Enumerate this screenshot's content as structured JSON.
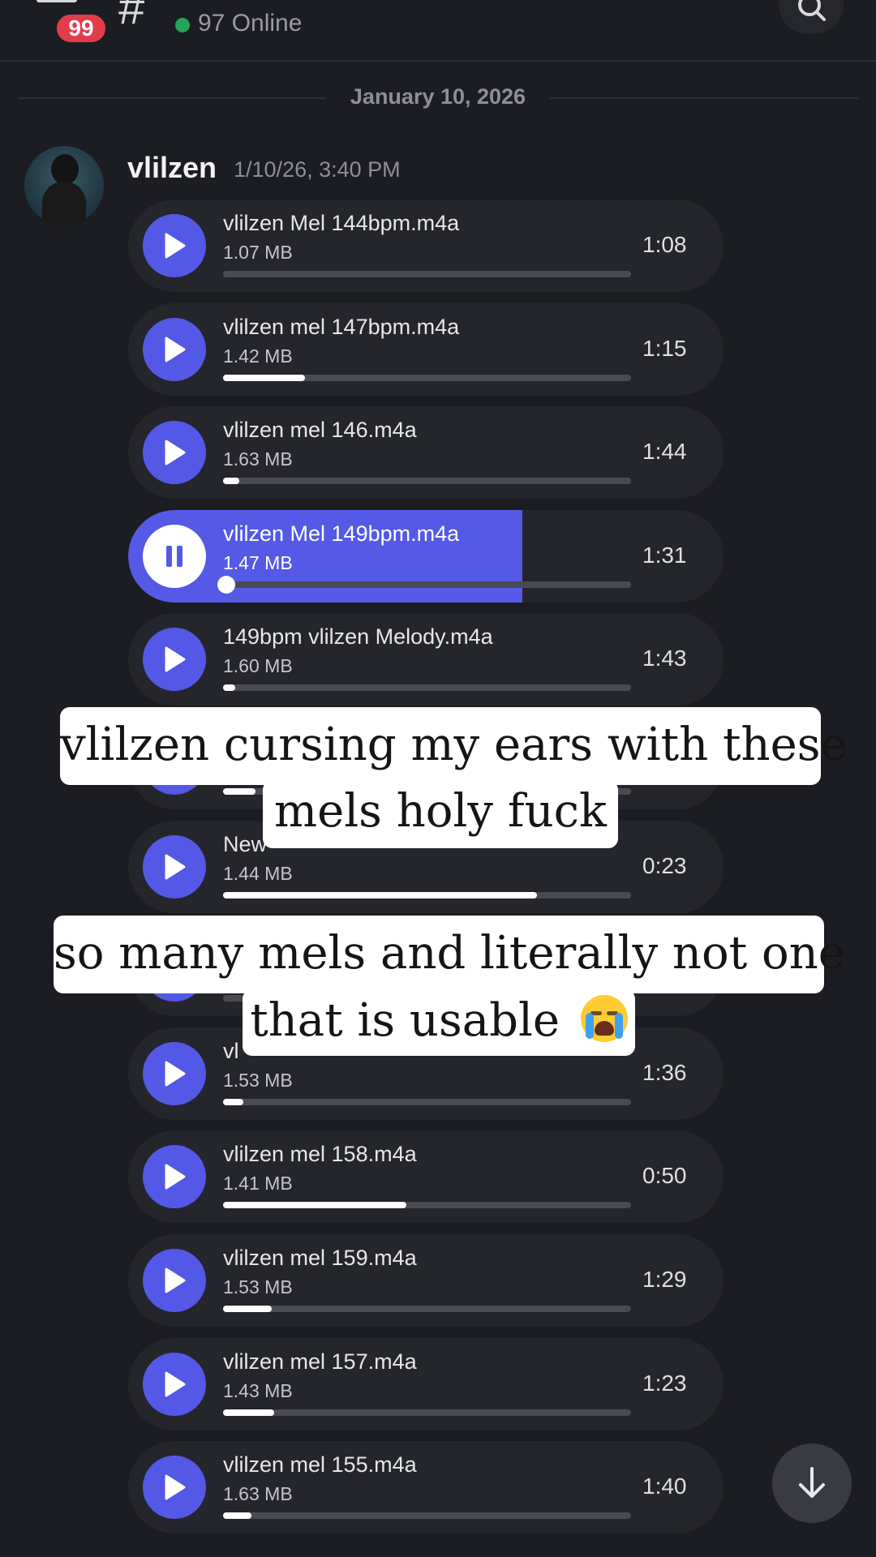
{
  "header": {
    "unread_badge": "99",
    "channel_icon": "hash-icon",
    "online_text": "97 Online",
    "online_color": "#23a55a",
    "search_icon": "search-icon"
  },
  "date_divider": "January 10, 2026",
  "message": {
    "username": "vlilzen",
    "timestamp": "1/10/26, 3:40 PM",
    "attachments": [
      {
        "title": "vlilzen Mel 144bpm.m4a",
        "size": "1.07 MB",
        "duration": "1:08",
        "progress": 0.0,
        "playing": false
      },
      {
        "title": "vlilzen mel 147bpm.m4a",
        "size": "1.42 MB",
        "duration": "1:15",
        "progress": 0.2,
        "playing": false
      },
      {
        "title": "vlilzen mel 146.m4a",
        "size": "1.63 MB",
        "duration": "1:44",
        "progress": 0.04,
        "playing": false
      },
      {
        "title": "vlilzen Mel 149bpm.m4a",
        "size": "1.47 MB",
        "duration": "1:31",
        "progress": 0.0,
        "playing": true
      },
      {
        "title": "149bpm vlilzen Melody.m4a",
        "size": "1.60 MB",
        "duration": "1:43",
        "progress": 0.03,
        "playing": false
      },
      {
        "title": "",
        "size": "",
        "duration": "",
        "progress": 0.08,
        "playing": false
      },
      {
        "title": "New",
        "size": "1.44 MB",
        "duration": "0:23",
        "progress": 0.77,
        "playing": false
      },
      {
        "title": "",
        "size": "",
        "duration": "",
        "progress": 0.0,
        "playing": false
      },
      {
        "title": "vl",
        "size": "1.53 MB",
        "duration": "1:36",
        "progress": 0.05,
        "playing": false
      },
      {
        "title": "vlilzen mel 158.m4a",
        "size": "1.41 MB",
        "duration": "0:50",
        "progress": 0.45,
        "playing": false
      },
      {
        "title": "vlilzen mel 159.m4a",
        "size": "1.53 MB",
        "duration": "1:29",
        "progress": 0.12,
        "playing": false
      },
      {
        "title": "vlilzen mel 157.m4a",
        "size": "1.43 MB",
        "duration": "1:23",
        "progress": 0.125,
        "playing": false
      },
      {
        "title": "vlilzen mel 155.m4a",
        "size": "1.63 MB",
        "duration": "1:40",
        "progress": 0.07,
        "playing": false
      }
    ]
  },
  "captions": {
    "first_line1": "vlilzen cursing my ears with these",
    "first_line2": "mels holy fuck",
    "second_line1": "so many mels and literally not one",
    "second_line2": "that is usable",
    "second_emoji": "loudly-crying-face-icon"
  },
  "colors": {
    "accent": "#5459e6",
    "background": "#1c1d22",
    "attachment_bg": "#25262c",
    "badge": "#e23c4a"
  }
}
